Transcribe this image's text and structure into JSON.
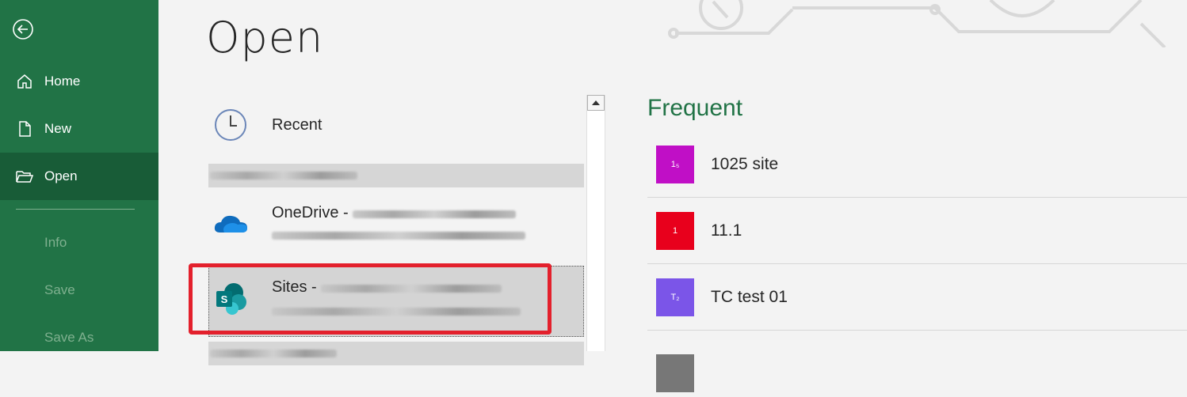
{
  "sidebar": {
    "back_icon": "back-arrow-icon",
    "items": [
      {
        "label": "Home",
        "icon": "home-icon"
      },
      {
        "label": "New",
        "icon": "new-document-icon"
      },
      {
        "label": "Open",
        "icon": "open-folder-icon"
      },
      {
        "label": "Info"
      },
      {
        "label": "Save"
      },
      {
        "label": "Save As"
      }
    ]
  },
  "main": {
    "title": "Open",
    "locations": {
      "recent": {
        "label": "Recent",
        "icon": "clock-icon"
      },
      "onedrive": {
        "label": "OneDrive - ",
        "icon": "onedrive-cloud-icon"
      },
      "sites": {
        "label": "Sites - ",
        "icon": "sharepoint-icon"
      }
    },
    "frequent": {
      "title": "Frequent",
      "items": [
        {
          "name": "1025 site",
          "badge": "1₅",
          "color": "#c00fc6"
        },
        {
          "name": "11.1",
          "badge": "1",
          "color": "#e8001c"
        },
        {
          "name": "TC test 01",
          "badge": "T₂",
          "color": "#7b55e8"
        },
        {
          "name": "",
          "badge": "",
          "color": "#777777"
        }
      ]
    }
  },
  "colors": {
    "accent": "#217346",
    "highlight": "#e3202c"
  }
}
